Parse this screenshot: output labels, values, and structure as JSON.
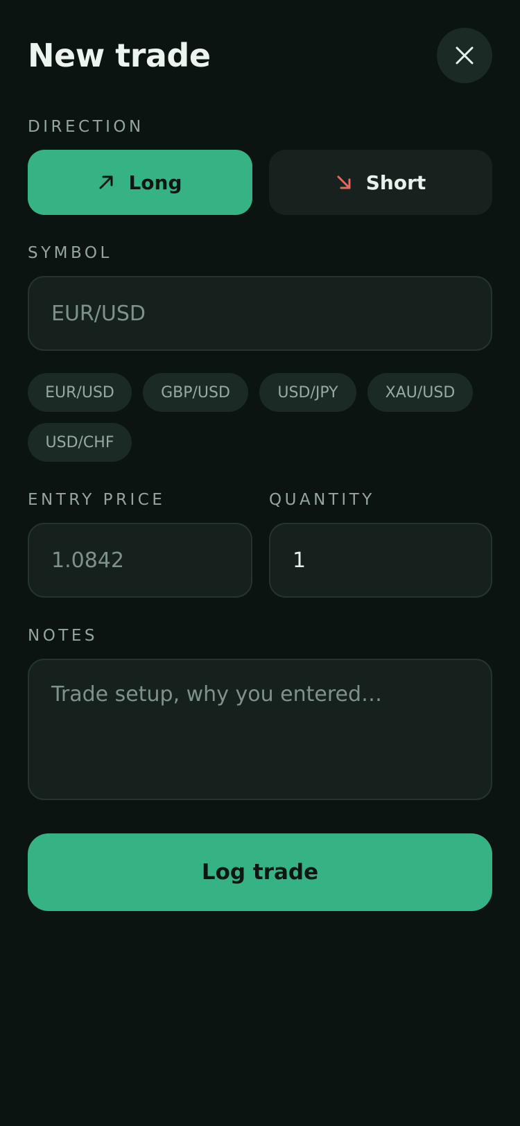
{
  "header": {
    "title": "New trade",
    "close_icon": "close-icon"
  },
  "direction": {
    "label": "DIRECTION",
    "selected": "Long",
    "long_label": "Long",
    "long_icon": "arrow-up-right-icon",
    "short_label": "Short",
    "short_icon": "arrow-down-right-icon"
  },
  "symbol": {
    "label": "SYMBOL",
    "placeholder": "EUR/USD",
    "value": "",
    "suggestions": [
      "EUR/USD",
      "GBP/USD",
      "USD/JPY",
      "XAU/USD",
      "USD/CHF"
    ]
  },
  "entry_price": {
    "label": "ENTRY PRICE",
    "placeholder": "1.0842",
    "value": ""
  },
  "quantity": {
    "label": "QUANTITY",
    "value": "1"
  },
  "notes": {
    "label": "NOTES",
    "placeholder": "Trade setup, why you entered…",
    "value": ""
  },
  "submit": {
    "label": "Log trade"
  },
  "colors": {
    "background": "#0b1411",
    "accent": "#35b385",
    "short_accent": "#e5675d",
    "surface": "#17221e"
  }
}
